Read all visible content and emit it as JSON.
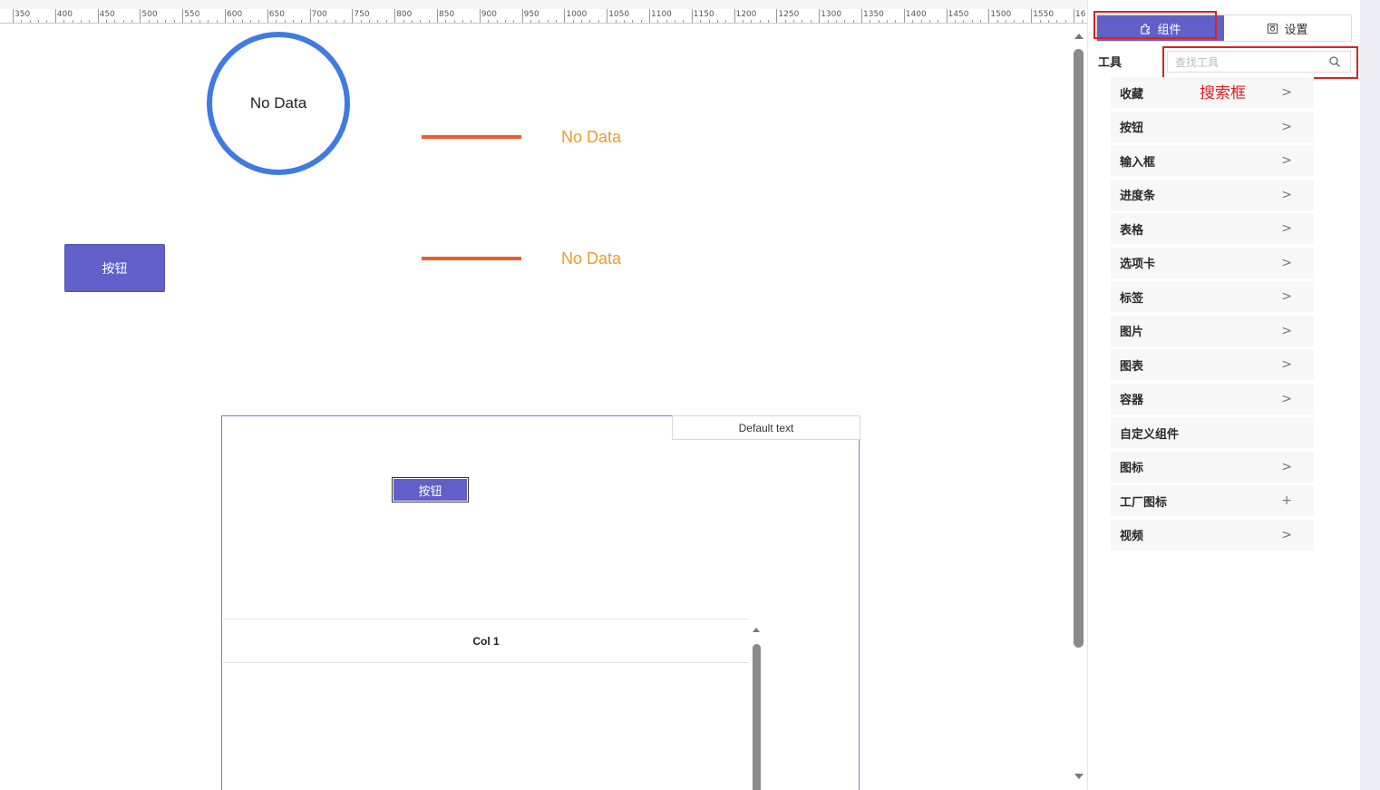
{
  "ruler": {
    "labels": [
      "350",
      "400",
      "450",
      "500",
      "550",
      "600",
      "650",
      "700",
      "750",
      "800",
      "850",
      "900",
      "950",
      "1000",
      "1050",
      "1100",
      "1150",
      "1200",
      "1250",
      "1300",
      "1350",
      "1400",
      "1450",
      "1500",
      "1550",
      "16"
    ]
  },
  "canvas": {
    "circle_text": "No Data",
    "line_labels": [
      "No Data",
      "No Data"
    ],
    "button_label": "按钮",
    "container": {
      "default_text": "Default text",
      "button_label": "按钮",
      "table_header": "Col 1"
    }
  },
  "panel": {
    "tabs": [
      {
        "label": "组件",
        "icon": "puzzle-icon",
        "active": true
      },
      {
        "label": "设置",
        "icon": "settings-icon",
        "active": false
      }
    ],
    "tools_label": "工具",
    "search_placeholder": "查找工具",
    "annotation": "搜索框",
    "items": [
      {
        "label": "收藏",
        "icon": ">"
      },
      {
        "label": "按钮",
        "icon": ">"
      },
      {
        "label": "输入框",
        "icon": ">"
      },
      {
        "label": "进度条",
        "icon": ">"
      },
      {
        "label": "表格",
        "icon": ">"
      },
      {
        "label": "选项卡",
        "icon": ">"
      },
      {
        "label": "标签",
        "icon": ">"
      },
      {
        "label": "图片",
        "icon": ">"
      },
      {
        "label": "图表",
        "icon": ">"
      },
      {
        "label": "容器",
        "icon": ">"
      },
      {
        "label": "自定义组件",
        "icon": ""
      },
      {
        "label": "图标",
        "icon": ">"
      },
      {
        "label": "工厂图标",
        "icon": "+"
      },
      {
        "label": "视频",
        "icon": ">"
      }
    ],
    "colors": {
      "accent": "#6160c8",
      "highlight": "#e02020",
      "circle": "#3f7be0",
      "line": "#f05a2a",
      "line_text": "#f09a2a"
    }
  }
}
